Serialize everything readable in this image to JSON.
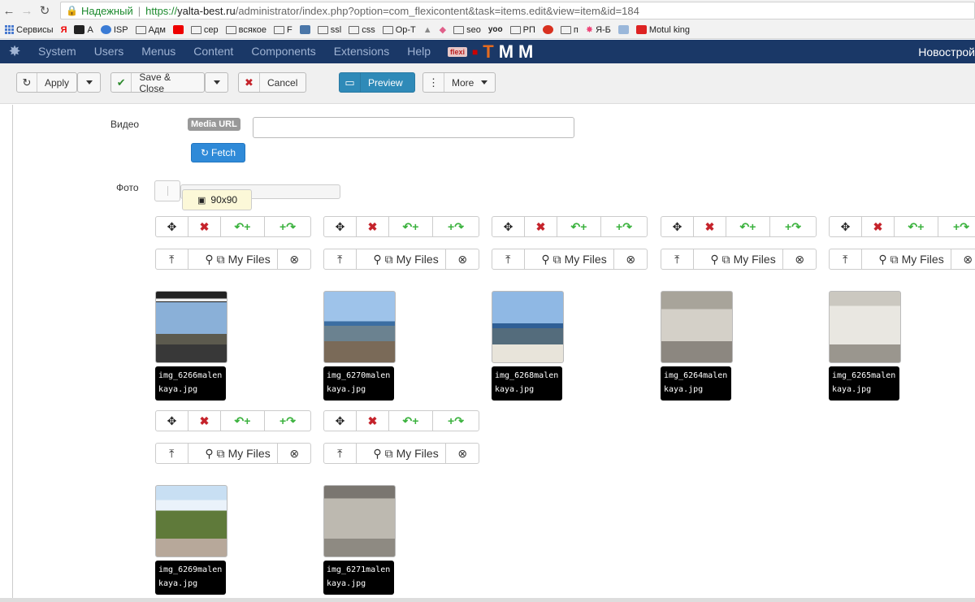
{
  "browser": {
    "secure_label": "Надежный",
    "url_scheme": "https://",
    "url_host": "yalta-best.ru",
    "url_path": "/administrator/index.php?option=com_flexicontent&task=items.edit&view=item&id=184"
  },
  "bookmarks": [
    {
      "label": "Сервисы",
      "icon": "apps-grid"
    },
    {
      "label": "",
      "icon": "yandex-y"
    },
    {
      "label": "А",
      "icon": "dark-square"
    },
    {
      "label": "ISP",
      "icon": "check-badge"
    },
    {
      "label": "Адм",
      "icon": "folder"
    },
    {
      "label": "",
      "icon": "youtube"
    },
    {
      "label": "сер",
      "icon": "folder"
    },
    {
      "label": "всякое",
      "icon": "folder"
    },
    {
      "label": "F",
      "icon": "folder"
    },
    {
      "label": "",
      "icon": "vk"
    },
    {
      "label": "ssl",
      "icon": "folder"
    },
    {
      "label": "css",
      "icon": "folder"
    },
    {
      "label": "Op-T",
      "icon": "folder"
    },
    {
      "label": "",
      "icon": "triangle"
    },
    {
      "label": "",
      "icon": "pink-diamond"
    },
    {
      "label": "seo",
      "icon": "folder"
    },
    {
      "label": "",
      "icon": "yoo"
    },
    {
      "label": "РП",
      "icon": "folder"
    },
    {
      "label": "",
      "icon": "ussr"
    },
    {
      "label": "п",
      "icon": "folder"
    },
    {
      "label": "Я-Б",
      "icon": "joomla"
    },
    {
      "label": "",
      "icon": "calendar"
    },
    {
      "label": "Motul king",
      "icon": "motul"
    }
  ],
  "menubar": {
    "items": [
      "System",
      "Users",
      "Menus",
      "Content",
      "Components",
      "Extensions",
      "Help"
    ],
    "logo_flexi": "flexi",
    "logo_t": "T",
    "logo_m": "M",
    "logo_m2": "M",
    "right": "Новострой"
  },
  "toolbar": {
    "apply": "Apply",
    "save_close": "Save & Close",
    "cancel": "Cancel",
    "preview": "Preview",
    "more": "More"
  },
  "form": {
    "video_label": "Видео",
    "media_url_badge": "Media URL",
    "fetch": "Fetch",
    "photo_label": "Фото",
    "size_tooltip": "90x90"
  },
  "cards": [
    {
      "filename": "img_6266malenkaya.jpg",
      "myfiles": "My Files"
    },
    {
      "filename": "img_6270malenkaya.jpg",
      "myfiles": "My Files"
    },
    {
      "filename": "img_6268malenkaya.jpg",
      "myfiles": "My Files"
    },
    {
      "filename": "img_6264malenkaya.jpg",
      "myfiles": "My Files"
    },
    {
      "filename": "img_6265malenkaya.jpg",
      "myfiles": "My Files"
    },
    {
      "filename": "img_6269malenkaya.jpg",
      "myfiles": "My Files"
    },
    {
      "filename": "img_6271malenkaya.jpg",
      "myfiles": "My Files"
    }
  ]
}
